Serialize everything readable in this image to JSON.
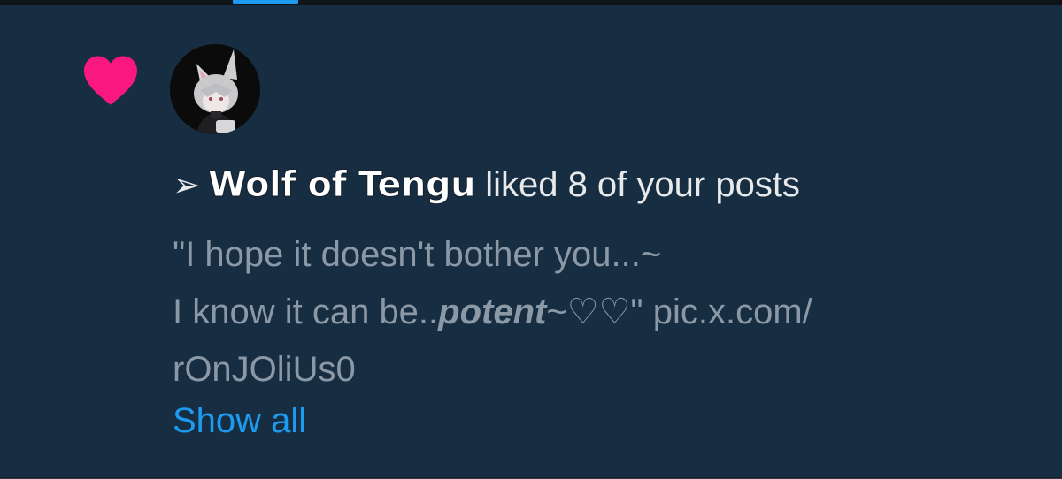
{
  "notification": {
    "type_icon": "heart-icon",
    "accent_color": "#f91880",
    "avatar_icon": "avatar",
    "arrow": "➢",
    "username": "Wolf of Tengu",
    "action_text": "liked 8 of your posts",
    "post_text": {
      "line1": "\"I hope it doesn't bother you...~",
      "line2_prefix": "I know it can be..",
      "line2_emphasis": "potent",
      "line2_suffix": "~♡♡\" ",
      "link_part1": "pic.x.com/",
      "link_part2": "rOnJOliUs0"
    },
    "show_all_label": "Show all"
  }
}
